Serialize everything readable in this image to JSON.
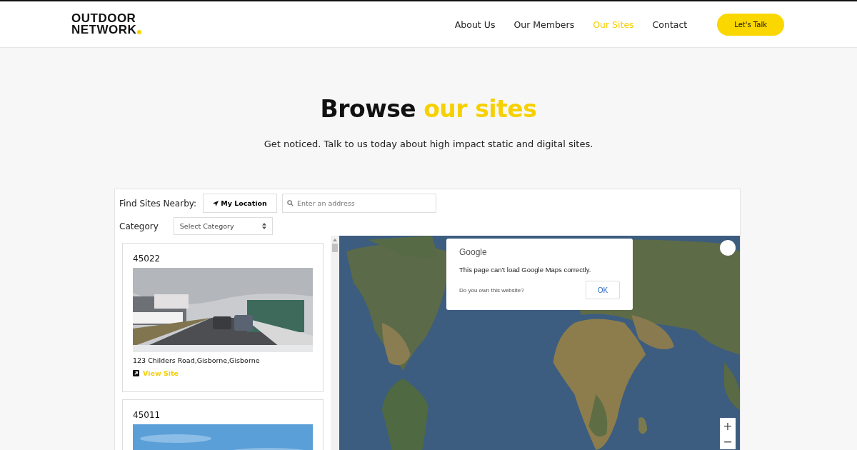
{
  "header": {
    "logo": {
      "line_1": "OUTDOOR",
      "line_2": "NETWORK"
    },
    "nav": [
      {
        "label": "About Us",
        "selected": false
      },
      {
        "label": "Our Members",
        "selected": false
      },
      {
        "label": "Our Sites",
        "selected": true
      },
      {
        "label": "Contact",
        "selected": false
      }
    ],
    "cta": "Let's Talk"
  },
  "hero": {
    "title": "Browse ",
    "title_highlight": "our sites",
    "subtitle": "Get noticed. Talk to us today about high impact static and digital sites."
  },
  "finder": {
    "nearby_label": "Find Sites Nearby:",
    "location_button": "My Location",
    "address_placeholder": "Enter an address",
    "category_label": "Category",
    "category_select": "Select Category"
  },
  "sites": [
    {
      "id": "45022",
      "kind": "picture",
      "address": "123 Childers Road,Gisborne,Gisborne",
      "link": "View Site"
    },
    {
      "id": "45011",
      "kind": "picture"
    }
  ],
  "map": {
    "kind": "picture",
    "dialog": {
      "brand": "Google",
      "message": "This page can't load Google Maps correctly.",
      "question": "Do you own this website?",
      "button": "OK"
    },
    "zoom_in": "+",
    "zoom_out": "−"
  }
}
